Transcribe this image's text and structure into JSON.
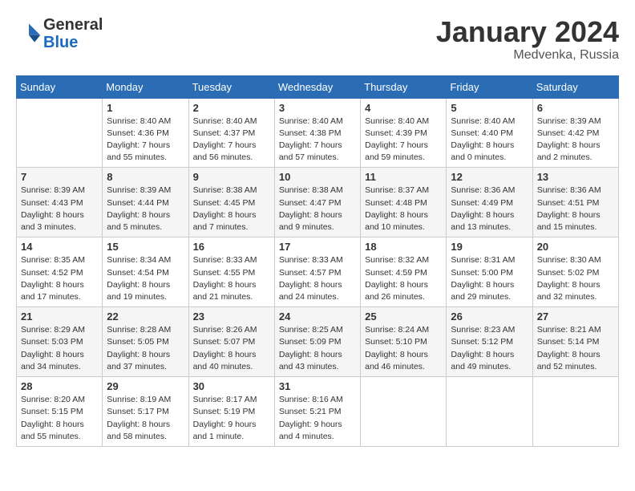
{
  "logo": {
    "general": "General",
    "blue": "Blue"
  },
  "header": {
    "title": "January 2024",
    "subtitle": "Medvenka, Russia"
  },
  "weekdays": [
    "Sunday",
    "Monday",
    "Tuesday",
    "Wednesday",
    "Thursday",
    "Friday",
    "Saturday"
  ],
  "weeks": [
    [
      {
        "day": "",
        "info": ""
      },
      {
        "day": "1",
        "info": "Sunrise: 8:40 AM\nSunset: 4:36 PM\nDaylight: 7 hours\nand 55 minutes."
      },
      {
        "day": "2",
        "info": "Sunrise: 8:40 AM\nSunset: 4:37 PM\nDaylight: 7 hours\nand 56 minutes."
      },
      {
        "day": "3",
        "info": "Sunrise: 8:40 AM\nSunset: 4:38 PM\nDaylight: 7 hours\nand 57 minutes."
      },
      {
        "day": "4",
        "info": "Sunrise: 8:40 AM\nSunset: 4:39 PM\nDaylight: 7 hours\nand 59 minutes."
      },
      {
        "day": "5",
        "info": "Sunrise: 8:40 AM\nSunset: 4:40 PM\nDaylight: 8 hours\nand 0 minutes."
      },
      {
        "day": "6",
        "info": "Sunrise: 8:39 AM\nSunset: 4:42 PM\nDaylight: 8 hours\nand 2 minutes."
      }
    ],
    [
      {
        "day": "7",
        "info": "Sunrise: 8:39 AM\nSunset: 4:43 PM\nDaylight: 8 hours\nand 3 minutes."
      },
      {
        "day": "8",
        "info": "Sunrise: 8:39 AM\nSunset: 4:44 PM\nDaylight: 8 hours\nand 5 minutes."
      },
      {
        "day": "9",
        "info": "Sunrise: 8:38 AM\nSunset: 4:45 PM\nDaylight: 8 hours\nand 7 minutes."
      },
      {
        "day": "10",
        "info": "Sunrise: 8:38 AM\nSunset: 4:47 PM\nDaylight: 8 hours\nand 9 minutes."
      },
      {
        "day": "11",
        "info": "Sunrise: 8:37 AM\nSunset: 4:48 PM\nDaylight: 8 hours\nand 10 minutes."
      },
      {
        "day": "12",
        "info": "Sunrise: 8:36 AM\nSunset: 4:49 PM\nDaylight: 8 hours\nand 13 minutes."
      },
      {
        "day": "13",
        "info": "Sunrise: 8:36 AM\nSunset: 4:51 PM\nDaylight: 8 hours\nand 15 minutes."
      }
    ],
    [
      {
        "day": "14",
        "info": "Sunrise: 8:35 AM\nSunset: 4:52 PM\nDaylight: 8 hours\nand 17 minutes."
      },
      {
        "day": "15",
        "info": "Sunrise: 8:34 AM\nSunset: 4:54 PM\nDaylight: 8 hours\nand 19 minutes."
      },
      {
        "day": "16",
        "info": "Sunrise: 8:33 AM\nSunset: 4:55 PM\nDaylight: 8 hours\nand 21 minutes."
      },
      {
        "day": "17",
        "info": "Sunrise: 8:33 AM\nSunset: 4:57 PM\nDaylight: 8 hours\nand 24 minutes."
      },
      {
        "day": "18",
        "info": "Sunrise: 8:32 AM\nSunset: 4:59 PM\nDaylight: 8 hours\nand 26 minutes."
      },
      {
        "day": "19",
        "info": "Sunrise: 8:31 AM\nSunset: 5:00 PM\nDaylight: 8 hours\nand 29 minutes."
      },
      {
        "day": "20",
        "info": "Sunrise: 8:30 AM\nSunset: 5:02 PM\nDaylight: 8 hours\nand 32 minutes."
      }
    ],
    [
      {
        "day": "21",
        "info": "Sunrise: 8:29 AM\nSunset: 5:03 PM\nDaylight: 8 hours\nand 34 minutes."
      },
      {
        "day": "22",
        "info": "Sunrise: 8:28 AM\nSunset: 5:05 PM\nDaylight: 8 hours\nand 37 minutes."
      },
      {
        "day": "23",
        "info": "Sunrise: 8:26 AM\nSunset: 5:07 PM\nDaylight: 8 hours\nand 40 minutes."
      },
      {
        "day": "24",
        "info": "Sunrise: 8:25 AM\nSunset: 5:09 PM\nDaylight: 8 hours\nand 43 minutes."
      },
      {
        "day": "25",
        "info": "Sunrise: 8:24 AM\nSunset: 5:10 PM\nDaylight: 8 hours\nand 46 minutes."
      },
      {
        "day": "26",
        "info": "Sunrise: 8:23 AM\nSunset: 5:12 PM\nDaylight: 8 hours\nand 49 minutes."
      },
      {
        "day": "27",
        "info": "Sunrise: 8:21 AM\nSunset: 5:14 PM\nDaylight: 8 hours\nand 52 minutes."
      }
    ],
    [
      {
        "day": "28",
        "info": "Sunrise: 8:20 AM\nSunset: 5:15 PM\nDaylight: 8 hours\nand 55 minutes."
      },
      {
        "day": "29",
        "info": "Sunrise: 8:19 AM\nSunset: 5:17 PM\nDaylight: 8 hours\nand 58 minutes."
      },
      {
        "day": "30",
        "info": "Sunrise: 8:17 AM\nSunset: 5:19 PM\nDaylight: 9 hours\nand 1 minute."
      },
      {
        "day": "31",
        "info": "Sunrise: 8:16 AM\nSunset: 5:21 PM\nDaylight: 9 hours\nand 4 minutes."
      },
      {
        "day": "",
        "info": ""
      },
      {
        "day": "",
        "info": ""
      },
      {
        "day": "",
        "info": ""
      }
    ]
  ]
}
